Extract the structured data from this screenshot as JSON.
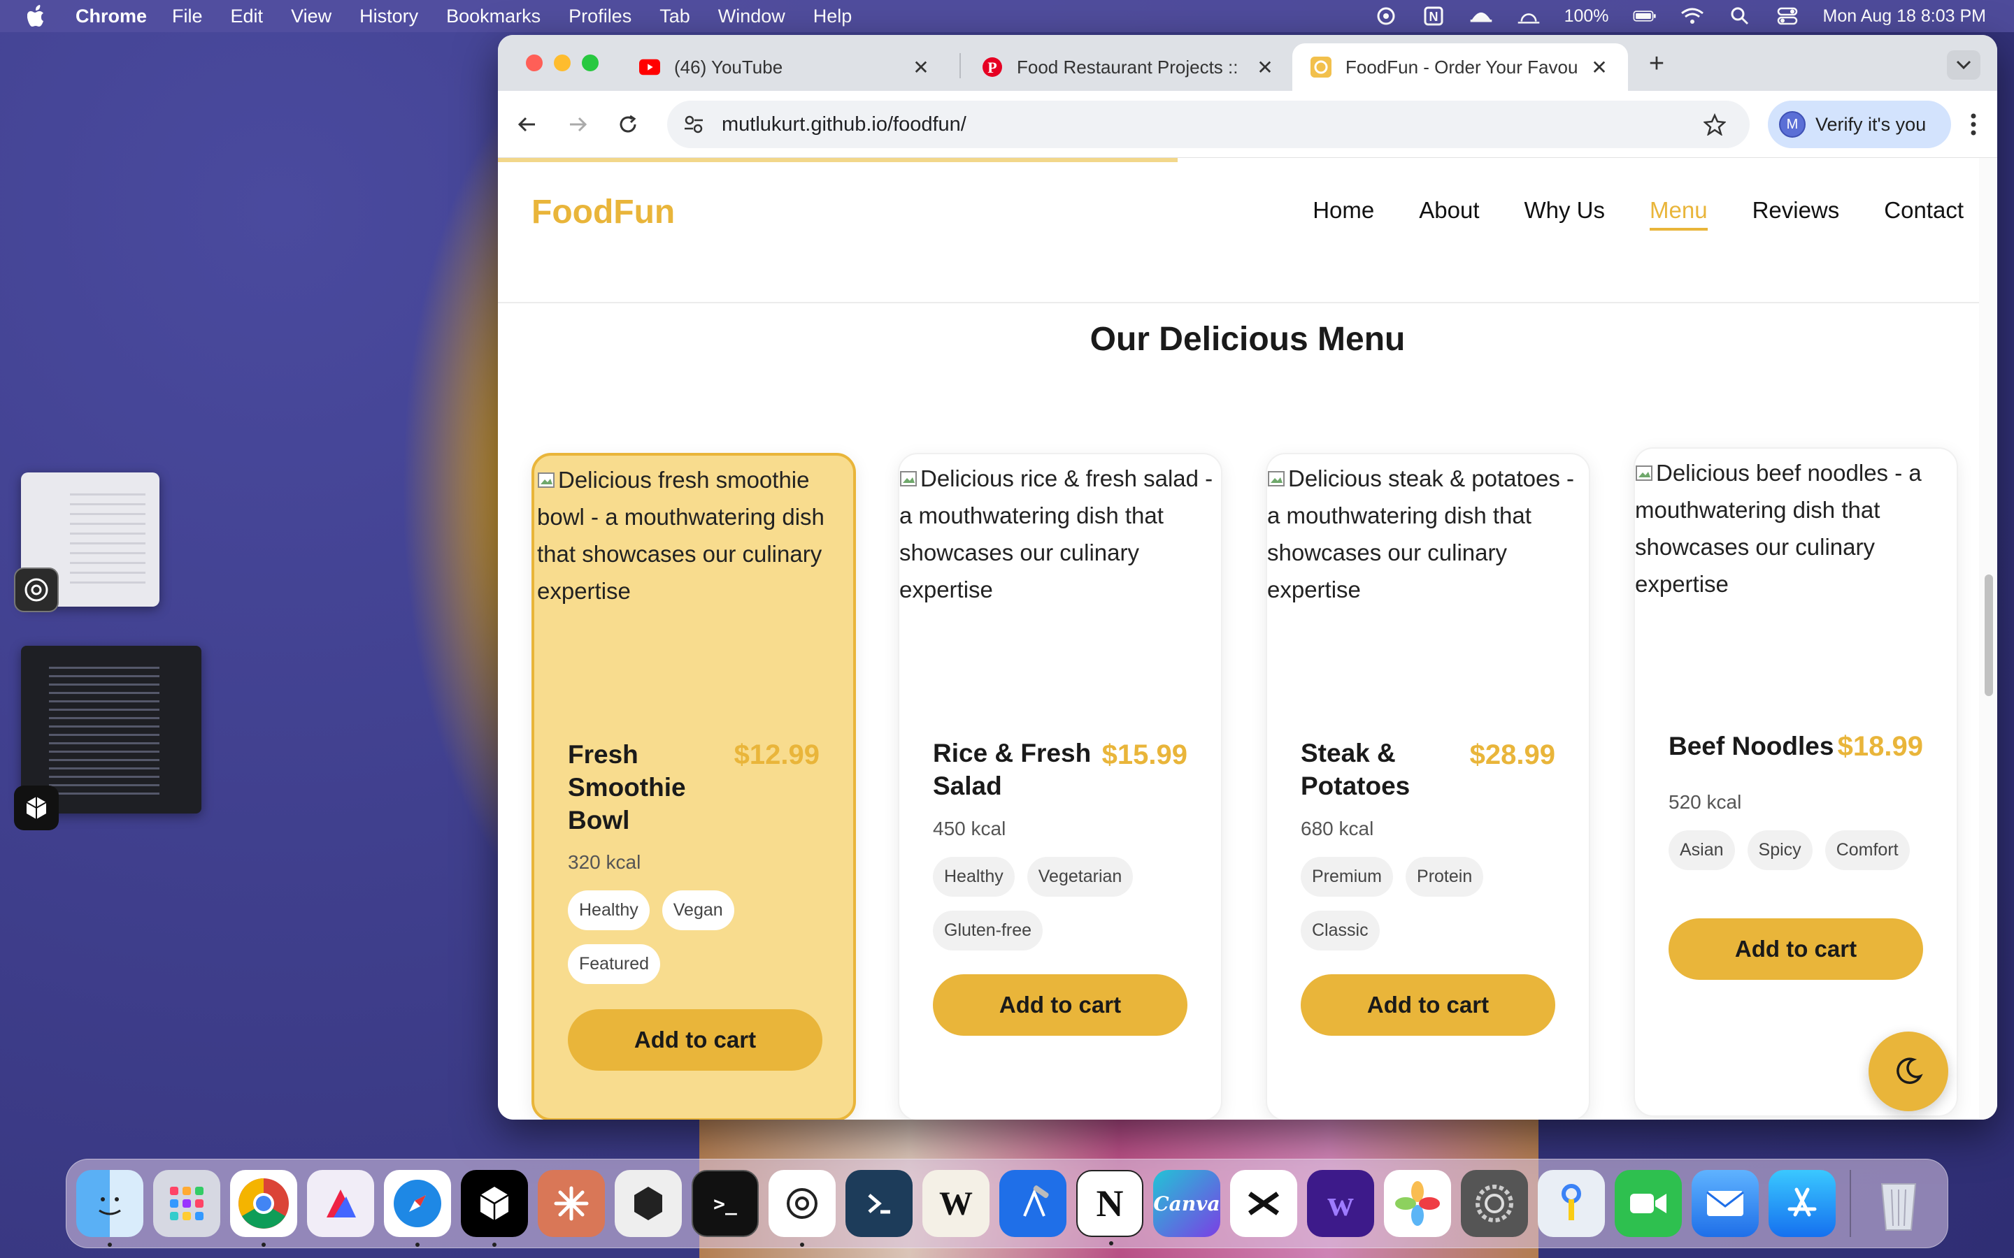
{
  "menubar": {
    "app_name": "Chrome",
    "items": [
      "File",
      "Edit",
      "View",
      "History",
      "Bookmarks",
      "Profiles",
      "Tab",
      "Window",
      "Help"
    ],
    "battery": "100%",
    "datetime": "Mon Aug 18  8:03 PM"
  },
  "browser": {
    "tabs": [
      {
        "title": "(46) YouTube",
        "icon": "youtube-icon"
      },
      {
        "title": "Food Restaurant Projects :: Pi",
        "icon": "pinterest-icon"
      },
      {
        "title": "FoodFun - Order Your Favouri",
        "icon": "foodfun-favicon",
        "active": true
      }
    ],
    "url": "mutlukurt.github.io/foodfun/",
    "profile_initial": "M",
    "verify_label": "Verify it's you"
  },
  "site": {
    "brand": "FoodFun",
    "nav": [
      {
        "label": "Home"
      },
      {
        "label": "About"
      },
      {
        "label": "Why Us"
      },
      {
        "label": "Menu",
        "active": true
      },
      {
        "label": "Reviews"
      },
      {
        "label": "Contact"
      }
    ],
    "section_title": "Our Delicious Menu",
    "accent_color": "#e9b53a",
    "cards": [
      {
        "alt": "Delicious fresh smoothie bowl - a mouthwatering dish that showcases our culinary expertise",
        "name": "Fresh Smoothie Bowl",
        "price": "$12.99",
        "kcal": "320 kcal",
        "tags": [
          "Healthy",
          "Vegan",
          "Featured"
        ],
        "cta": "Add to cart",
        "featured": true
      },
      {
        "alt": "Delicious rice & fresh salad - a mouthwatering dish that showcases our culinary expertise",
        "name": "Rice & Fresh Salad",
        "price": "$15.99",
        "kcal": "450 kcal",
        "tags": [
          "Healthy",
          "Vegetarian",
          "Gluten-free"
        ],
        "cta": "Add to cart"
      },
      {
        "alt": "Delicious steak & potatoes - a mouthwatering dish that showcases our culinary expertise",
        "name": "Steak & Potatoes",
        "price": "$28.99",
        "kcal": "680 kcal",
        "tags": [
          "Premium",
          "Protein",
          "Classic"
        ],
        "cta": "Add to cart"
      },
      {
        "alt": "Delicious beef noodles - a mouthwatering dish that showcases our culinary expertise",
        "name": "Beef Noodles",
        "price": "$18.99",
        "kcal": "520 kcal",
        "tags": [
          "Asian",
          "Spicy",
          "Comfort"
        ],
        "cta": "Add to cart"
      }
    ]
  },
  "dock": {
    "apps": [
      "finder-icon",
      "launchpad-icon",
      "chrome-icon",
      "affinity-icon",
      "safari-icon",
      "cube-app-icon",
      "claude-icon",
      "box-app-icon",
      "terminal-icon",
      "chatgpt-icon",
      "dev-tool-icon",
      "writer-icon",
      "xcode-icon",
      "notion-icon",
      "canva-icon",
      "capcut-icon",
      "wave-icon",
      "photos-icon",
      "system-settings-icon",
      "keychain-icon",
      "facetime-icon",
      "mail-icon",
      "app-store-icon",
      "trash-icon"
    ],
    "canva_label": "Canva"
  }
}
